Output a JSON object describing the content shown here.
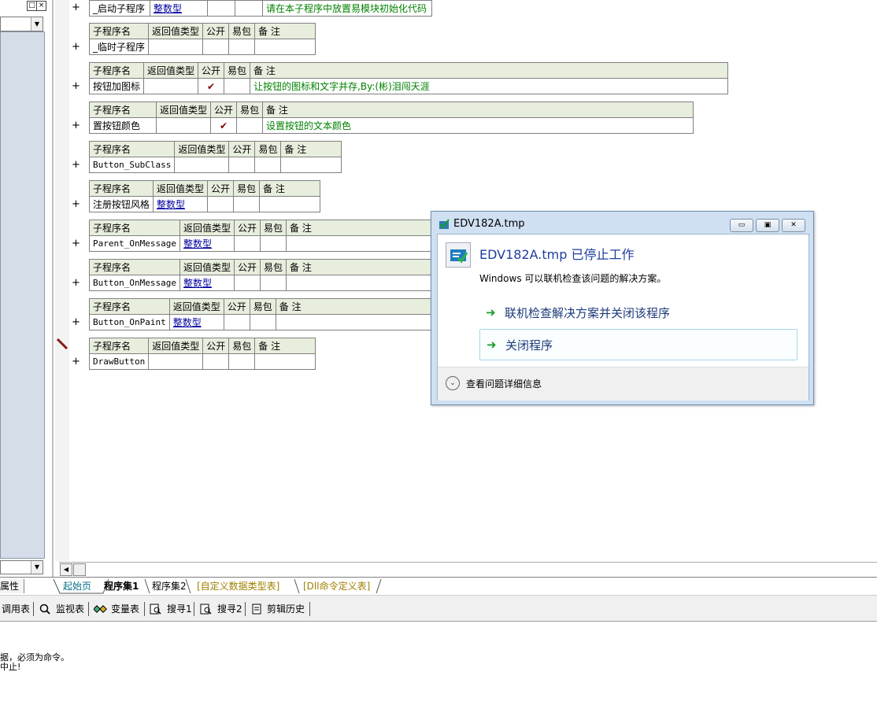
{
  "left_panel": {
    "title_buttons": [
      "□",
      "×"
    ],
    "combo_arrow": "▼",
    "scroll_arrow": "▼"
  },
  "header_labels": {
    "name": "子程序名",
    "return_type": "返回值类型",
    "public": "公开",
    "easy_pack": "易包",
    "note": "备 注"
  },
  "gutter": {
    "plus": "+"
  },
  "subroutines": [
    {
      "name": "_启动子程序",
      "return_type": "整数型",
      "public": "",
      "easy_pack": "",
      "note": "请在本子程序中放置易模块初始化代码"
    },
    {
      "name": "_临时子程序",
      "return_type": "",
      "public": "",
      "easy_pack": "",
      "note": ""
    },
    {
      "name": "按钮加图标",
      "return_type": "",
      "public": "✔",
      "easy_pack": "",
      "note": "让按钮的图标和文字并存,By:(彬)泪闯天涯"
    },
    {
      "name": "置按钮颜色",
      "return_type": "",
      "public": "✔",
      "easy_pack": "",
      "note": "设置按钮的文本颜色"
    },
    {
      "name": "Button_SubClass",
      "return_type": "",
      "public": "",
      "easy_pack": "",
      "note": ""
    },
    {
      "name": "注册按钮风格",
      "return_type": "整数型",
      "public": "",
      "easy_pack": "",
      "note": ""
    },
    {
      "name": "Parent_OnMessage",
      "return_type": "整数型",
      "public": "",
      "easy_pack": "",
      "note": ""
    },
    {
      "name": "Button_OnMessage",
      "return_type": "整数型",
      "public": "",
      "easy_pack": "",
      "note": ""
    },
    {
      "name": "Button_OnPaint",
      "return_type": "整数型",
      "public": "",
      "easy_pack": "",
      "note": ""
    },
    {
      "name": "DrawButton",
      "return_type": "",
      "public": "",
      "easy_pack": "",
      "note": ""
    }
  ],
  "tabs": {
    "properties": "属性",
    "start_page": "起始页",
    "set1": "程序集1",
    "set2": "程序集2",
    "custom_types": "[自定义数据类型表]",
    "dll_table": "[Dll命令定义表]"
  },
  "toolbar": {
    "call_table": "调用表",
    "watch_table": "监视表",
    "var_table": "变量表",
    "search1": "搜寻1",
    "search2": "搜寻2",
    "clip_history": "剪辑历史"
  },
  "output": {
    "line1": "据，必须为命令。",
    "line2": "中止!"
  },
  "dialog": {
    "title": "EDV182A.tmp",
    "heading": "EDV182A.tmp 已停止工作",
    "message": "Windows 可以联机检查该问题的解决方案。",
    "option1": "联机检查解决方案并关闭该程序",
    "option2": "关闭程序",
    "details": "查看问题详细信息",
    "btn_min": "▭",
    "btn_max": "▣",
    "btn_close": "✕"
  },
  "colors": {
    "header_bg": "#e8eedd",
    "type_link": "#0000a0",
    "note_green": "#008000",
    "dialog_heading": "#1e3d9f",
    "arrow_green": "#1a9c2b"
  }
}
